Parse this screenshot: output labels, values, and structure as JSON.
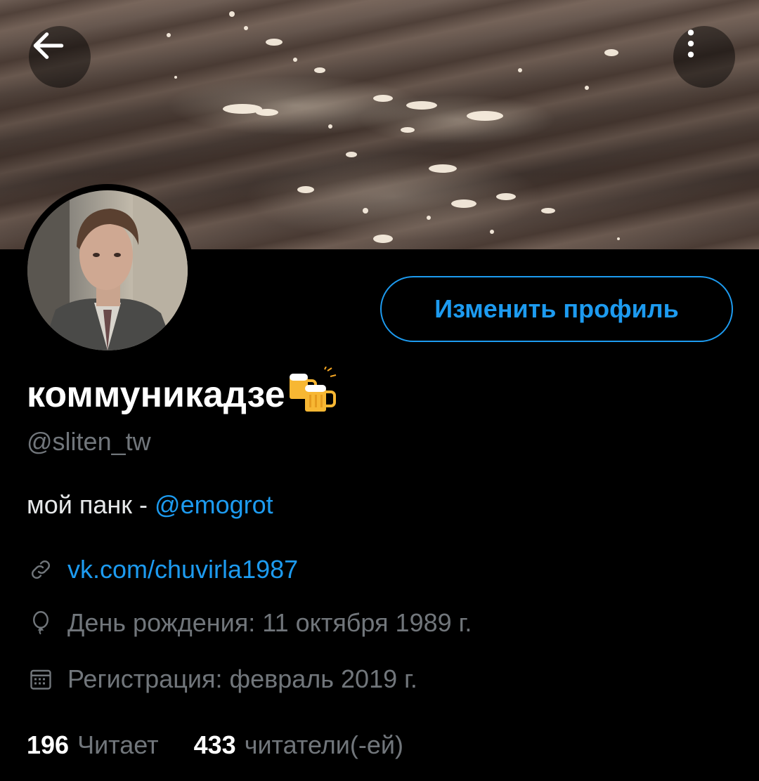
{
  "header": {
    "back_icon": "arrow-left-icon",
    "more_icon": "more-vertical-icon"
  },
  "profile": {
    "display_name": "коммуникадзе",
    "emoji": "beer-mugs-icon",
    "handle": "@sliten_tw",
    "edit_button_label": "Изменить профиль",
    "bio_text": "мой панк - ",
    "bio_mention": "@emogrot",
    "link_icon": "link-icon",
    "link": "vk.com/chuvirla1987",
    "birthday_icon": "balloon-icon",
    "birthday": "День рождения: 11 октября 1989 г.",
    "joined_icon": "calendar-icon",
    "joined": "Регистрация: февраль 2019 г.",
    "following_count": "196",
    "following_label": "Читает",
    "followers_count": "433",
    "followers_label": "читатели(-ей)"
  },
  "colors": {
    "accent": "#1d9bf0",
    "secondary_text": "#71767b",
    "background": "#000000"
  }
}
